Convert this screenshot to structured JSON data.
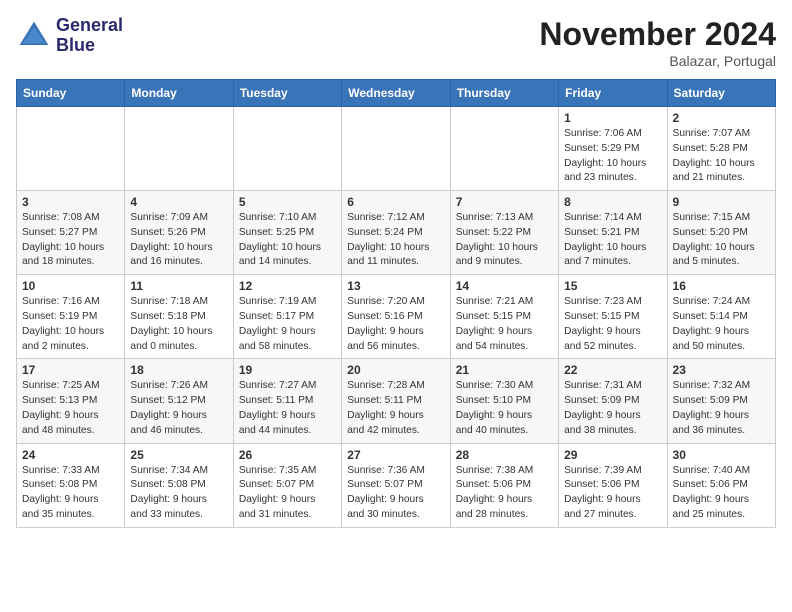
{
  "logo": {
    "line1": "General",
    "line2": "Blue"
  },
  "title": "November 2024",
  "subtitle": "Balazar, Portugal",
  "days_of_week": [
    "Sunday",
    "Monday",
    "Tuesday",
    "Wednesday",
    "Thursday",
    "Friday",
    "Saturday"
  ],
  "weeks": [
    [
      {
        "num": "",
        "info": ""
      },
      {
        "num": "",
        "info": ""
      },
      {
        "num": "",
        "info": ""
      },
      {
        "num": "",
        "info": ""
      },
      {
        "num": "",
        "info": ""
      },
      {
        "num": "1",
        "info": "Sunrise: 7:06 AM\nSunset: 5:29 PM\nDaylight: 10 hours\nand 23 minutes."
      },
      {
        "num": "2",
        "info": "Sunrise: 7:07 AM\nSunset: 5:28 PM\nDaylight: 10 hours\nand 21 minutes."
      }
    ],
    [
      {
        "num": "3",
        "info": "Sunrise: 7:08 AM\nSunset: 5:27 PM\nDaylight: 10 hours\nand 18 minutes."
      },
      {
        "num": "4",
        "info": "Sunrise: 7:09 AM\nSunset: 5:26 PM\nDaylight: 10 hours\nand 16 minutes."
      },
      {
        "num": "5",
        "info": "Sunrise: 7:10 AM\nSunset: 5:25 PM\nDaylight: 10 hours\nand 14 minutes."
      },
      {
        "num": "6",
        "info": "Sunrise: 7:12 AM\nSunset: 5:24 PM\nDaylight: 10 hours\nand 11 minutes."
      },
      {
        "num": "7",
        "info": "Sunrise: 7:13 AM\nSunset: 5:22 PM\nDaylight: 10 hours\nand 9 minutes."
      },
      {
        "num": "8",
        "info": "Sunrise: 7:14 AM\nSunset: 5:21 PM\nDaylight: 10 hours\nand 7 minutes."
      },
      {
        "num": "9",
        "info": "Sunrise: 7:15 AM\nSunset: 5:20 PM\nDaylight: 10 hours\nand 5 minutes."
      }
    ],
    [
      {
        "num": "10",
        "info": "Sunrise: 7:16 AM\nSunset: 5:19 PM\nDaylight: 10 hours\nand 2 minutes."
      },
      {
        "num": "11",
        "info": "Sunrise: 7:18 AM\nSunset: 5:18 PM\nDaylight: 10 hours\nand 0 minutes."
      },
      {
        "num": "12",
        "info": "Sunrise: 7:19 AM\nSunset: 5:17 PM\nDaylight: 9 hours\nand 58 minutes."
      },
      {
        "num": "13",
        "info": "Sunrise: 7:20 AM\nSunset: 5:16 PM\nDaylight: 9 hours\nand 56 minutes."
      },
      {
        "num": "14",
        "info": "Sunrise: 7:21 AM\nSunset: 5:15 PM\nDaylight: 9 hours\nand 54 minutes."
      },
      {
        "num": "15",
        "info": "Sunrise: 7:23 AM\nSunset: 5:15 PM\nDaylight: 9 hours\nand 52 minutes."
      },
      {
        "num": "16",
        "info": "Sunrise: 7:24 AM\nSunset: 5:14 PM\nDaylight: 9 hours\nand 50 minutes."
      }
    ],
    [
      {
        "num": "17",
        "info": "Sunrise: 7:25 AM\nSunset: 5:13 PM\nDaylight: 9 hours\nand 48 minutes."
      },
      {
        "num": "18",
        "info": "Sunrise: 7:26 AM\nSunset: 5:12 PM\nDaylight: 9 hours\nand 46 minutes."
      },
      {
        "num": "19",
        "info": "Sunrise: 7:27 AM\nSunset: 5:11 PM\nDaylight: 9 hours\nand 44 minutes."
      },
      {
        "num": "20",
        "info": "Sunrise: 7:28 AM\nSunset: 5:11 PM\nDaylight: 9 hours\nand 42 minutes."
      },
      {
        "num": "21",
        "info": "Sunrise: 7:30 AM\nSunset: 5:10 PM\nDaylight: 9 hours\nand 40 minutes."
      },
      {
        "num": "22",
        "info": "Sunrise: 7:31 AM\nSunset: 5:09 PM\nDaylight: 9 hours\nand 38 minutes."
      },
      {
        "num": "23",
        "info": "Sunrise: 7:32 AM\nSunset: 5:09 PM\nDaylight: 9 hours\nand 36 minutes."
      }
    ],
    [
      {
        "num": "24",
        "info": "Sunrise: 7:33 AM\nSunset: 5:08 PM\nDaylight: 9 hours\nand 35 minutes."
      },
      {
        "num": "25",
        "info": "Sunrise: 7:34 AM\nSunset: 5:08 PM\nDaylight: 9 hours\nand 33 minutes."
      },
      {
        "num": "26",
        "info": "Sunrise: 7:35 AM\nSunset: 5:07 PM\nDaylight: 9 hours\nand 31 minutes."
      },
      {
        "num": "27",
        "info": "Sunrise: 7:36 AM\nSunset: 5:07 PM\nDaylight: 9 hours\nand 30 minutes."
      },
      {
        "num": "28",
        "info": "Sunrise: 7:38 AM\nSunset: 5:06 PM\nDaylight: 9 hours\nand 28 minutes."
      },
      {
        "num": "29",
        "info": "Sunrise: 7:39 AM\nSunset: 5:06 PM\nDaylight: 9 hours\nand 27 minutes."
      },
      {
        "num": "30",
        "info": "Sunrise: 7:40 AM\nSunset: 5:06 PM\nDaylight: 9 hours\nand 25 minutes."
      }
    ]
  ]
}
